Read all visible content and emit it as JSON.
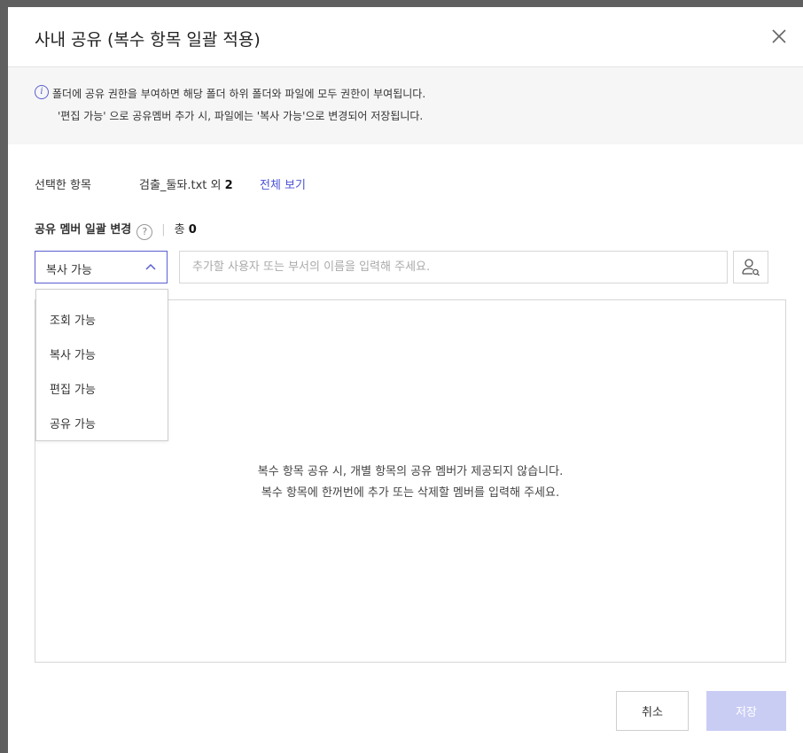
{
  "dialog": {
    "title": "사내 공유 (복수 항목 일괄 적용)"
  },
  "info": {
    "line1": "폴더에 공유 권한을 부여하면 해당 폴더 하위 폴더와 파일에 모두 권한이 부여됩니다.",
    "line2": "'편집 가능' 으로 공유멤버 추가 시, 파일에는 '복사 가능'으로 변경되어 저장됩니다."
  },
  "selection": {
    "label": "선택한 항목",
    "file_name": "검출_둘돠.txt",
    "others_prefix": " 외 ",
    "others_count": "2",
    "view_all": "전체 보기"
  },
  "members": {
    "label": "공유 멤버 일괄 변경",
    "help_icon_glyph": "?",
    "separator": "|",
    "total_label": "총 ",
    "total_count": "0"
  },
  "permission": {
    "selected": "복사 가능",
    "options": [
      "조회 가능",
      "복사 가능",
      "편집 가능",
      "공유 가능"
    ]
  },
  "search": {
    "placeholder": "추가할 사용자 또는 부서의 이름을 입력해 주세요."
  },
  "empty_state": {
    "line1": "복수 항목 공유 시, 개별 항목의 공유 멤버가 제공되지 않습니다.",
    "line2": "복수 항목에 한꺼번에 추가 또는 삭제할 멤버를 입력해 주세요."
  },
  "footer": {
    "cancel_label": "취소",
    "save_label": "저장"
  },
  "colors": {
    "accent": "#5a5fd0",
    "link": "#4a52d6",
    "save_disabled_bg": "#c9cdf4",
    "info_bg": "#f6f6f6"
  },
  "icons": {
    "close": "close-icon",
    "info": "info-icon",
    "help": "help-icon",
    "chevron": "chevron-up-icon",
    "user_search": "user-search-icon"
  }
}
